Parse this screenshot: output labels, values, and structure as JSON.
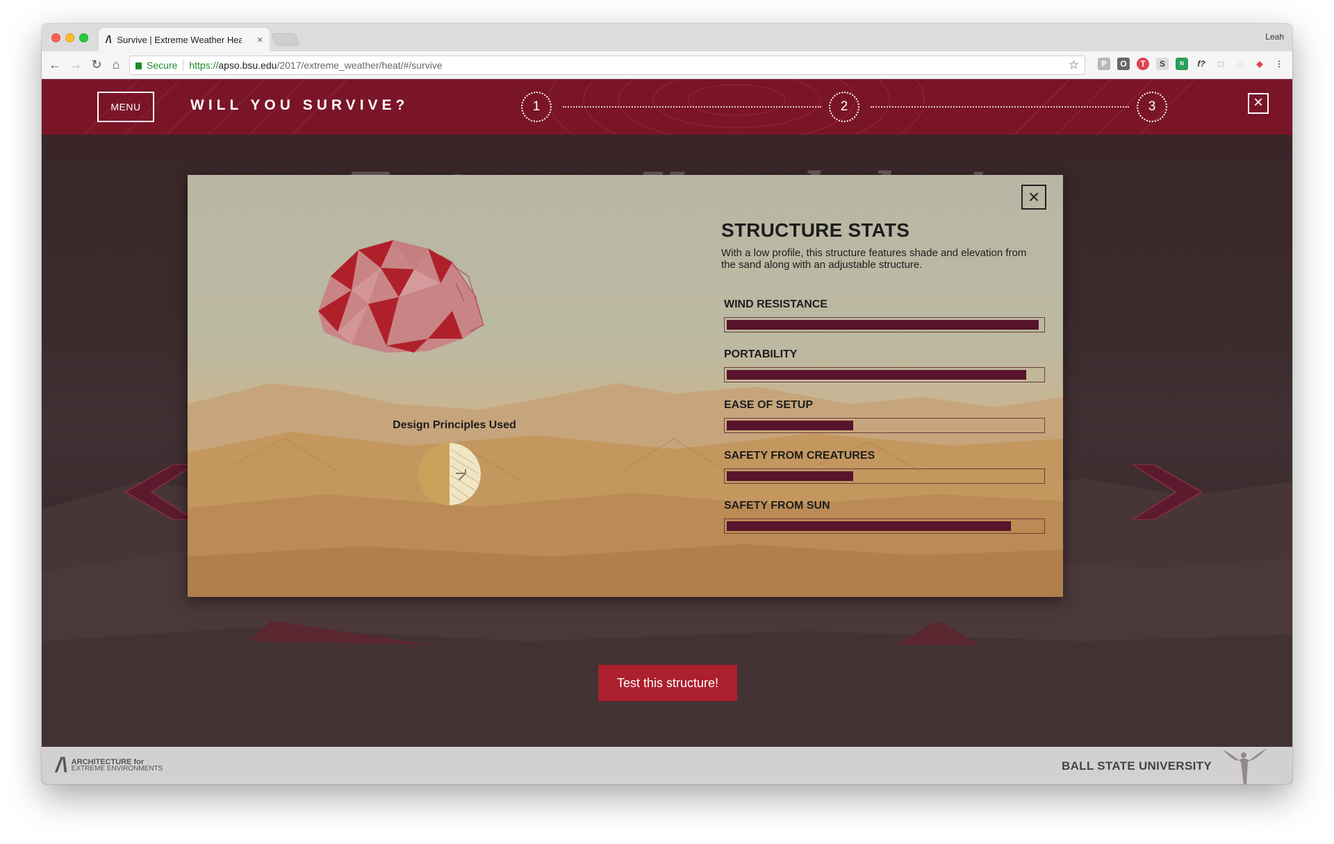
{
  "browser": {
    "tab_title": "Survive | Extreme Weather Hea",
    "tab_close": "×",
    "profile_name": "Leah",
    "secure_label": "Secure",
    "url_scheme": "https://",
    "url_host": "apso.bsu.edu",
    "url_path": "/2017/extreme_weather/heat/#/survive",
    "extensions": [
      "P",
      "O",
      "T",
      "S",
      "N",
      "f?",
      "□",
      "◌",
      "◆"
    ]
  },
  "header": {
    "menu_label": "MENU",
    "title": "WILL YOU SURVIVE?",
    "steps": [
      "1",
      "2",
      "3"
    ],
    "close_label": "×"
  },
  "page": {
    "heading": "Test your Knowledge!"
  },
  "modal": {
    "close_label": "×",
    "stats_title": "STRUCTURE STATS",
    "stats_description": "With a low profile, this structure features shade and elevation from the sand along with an adjustable structure.",
    "design_principles_label": "Design Principles Used",
    "stats": [
      {
        "label": "WIND RESISTANCE",
        "value": 0.99
      },
      {
        "label": "PORTABILITY",
        "value": 0.95
      },
      {
        "label": "EASE OF SETUP",
        "value": 0.4
      },
      {
        "label": "SAFETY FROM CREATURES",
        "value": 0.4
      },
      {
        "label": "SAFETY FROM SUN",
        "value": 0.9
      }
    ]
  },
  "actions": {
    "test_button": "Test this structure!"
  },
  "footer": {
    "logo_mark": "/\\",
    "logo_line1": "ARCHITECTURE for",
    "logo_line2": "EXTREME ENVIRONMENTS",
    "university": "BALL STATE UNIVERSITY"
  },
  "colors": {
    "header": "#7a1528",
    "bar_fill": "#57142a",
    "button": "#ac1f2d",
    "arrow": "#5c1a2e"
  }
}
